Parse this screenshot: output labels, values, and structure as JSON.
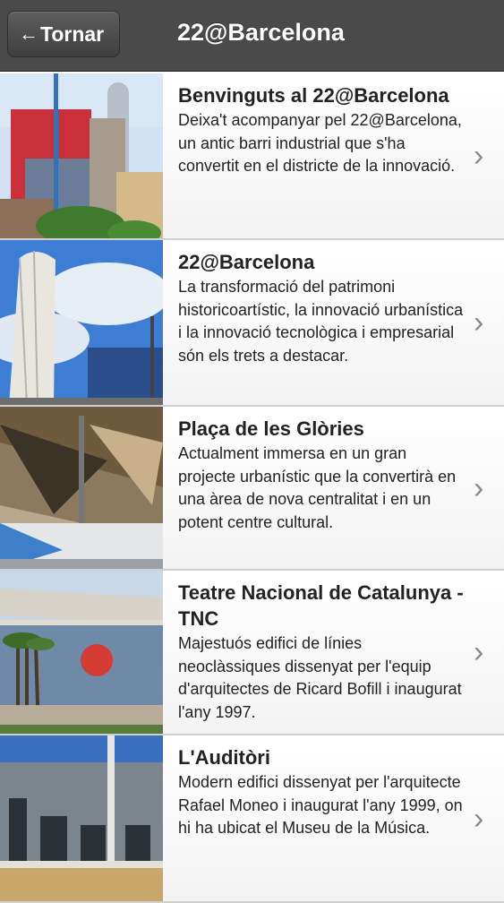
{
  "navbar": {
    "back_label": "Tornar",
    "title": "22@Barcelona"
  },
  "items": [
    {
      "title": "Benvinguts al 22@Barcelona",
      "description": "Deixa't acompanyar pel 22@Barcelona, un antic barri industrial que s'ha convertit en el districte de la innovació."
    },
    {
      "title": "22@Barcelona",
      "description": "La transformació del patrimoni historicoartístic, la innovació urbanística i la innovació tecnològica i empresarial són els trets a destacar."
    },
    {
      "title": "Plaça de les Glòries",
      "description": "Actualment immersa en un gran projecte urbanístic que la convertirà en una àrea de nova centralitat i en un potent centre cultural."
    },
    {
      "title": "Teatre Nacional de Catalunya - TNC",
      "description": "Majestuós edifici de línies neoclàssiques dissenyat per l'equip d'arquitectes de Ricard Bofill i inaugurat l'any 1997."
    },
    {
      "title": "L'Auditòri",
      "description": "Modern edifici dissenyat per l'arquitecte Rafael Moneo i inaugurat l'any 1999, on hi ha ubicat el Museu de la Música."
    }
  ],
  "icons": {
    "back": "left-arrow-icon",
    "disclosure": "chevron-right-icon"
  }
}
